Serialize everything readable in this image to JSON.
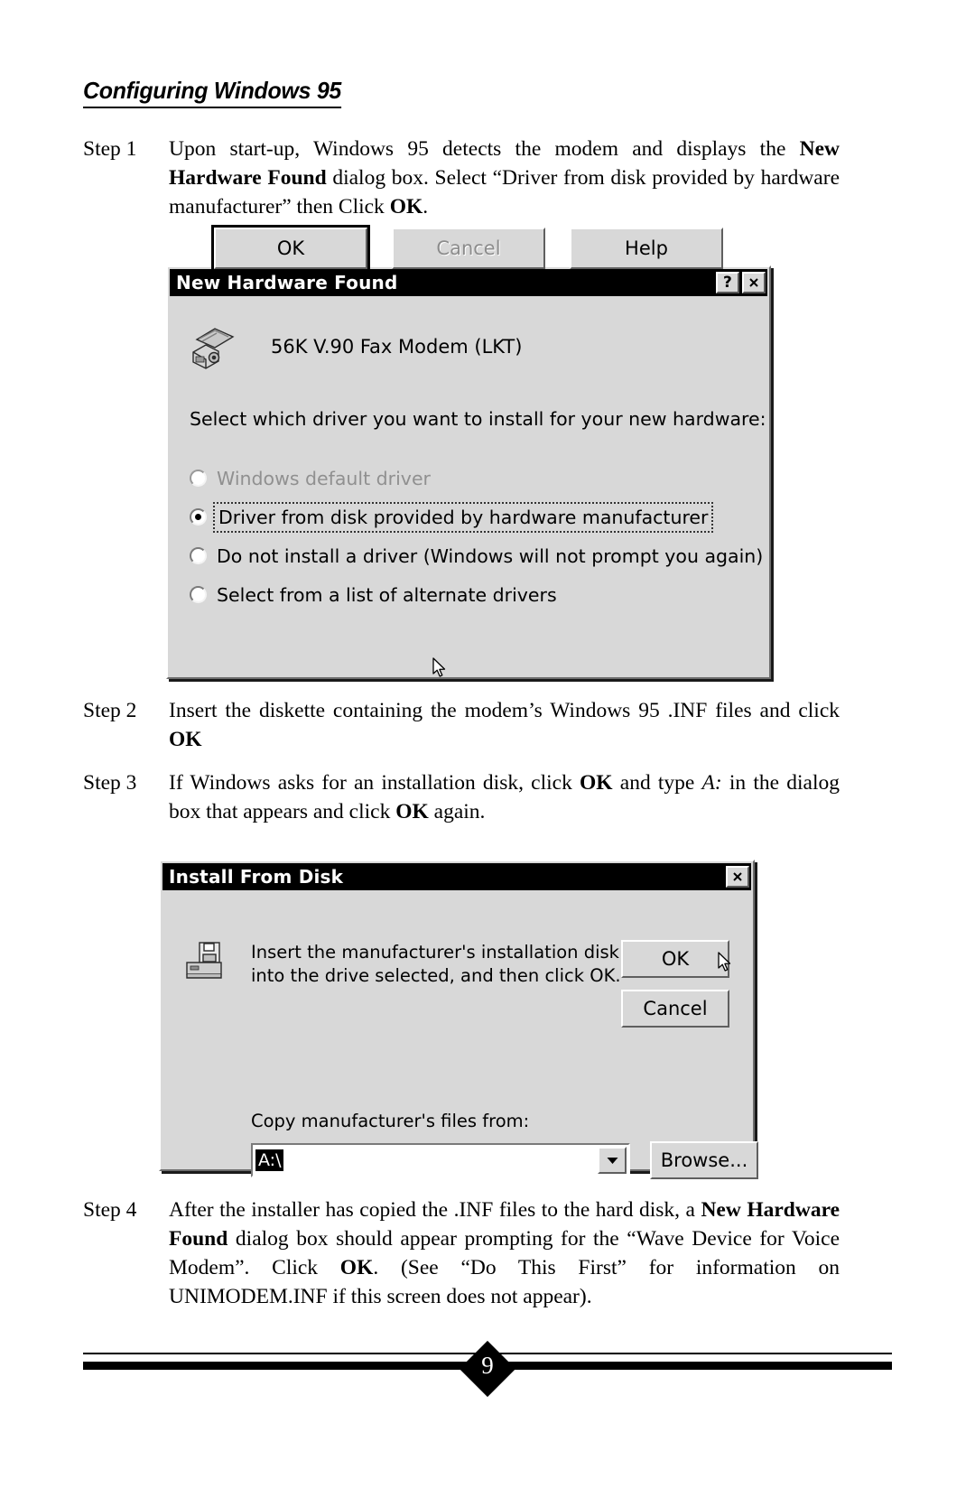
{
  "page": {
    "heading": "Configuring Windows 95",
    "page_number": "9"
  },
  "steps": [
    {
      "label": "Step 1",
      "text_html": "Upon start-up, Windows 95 detects the modem and displays the <b>New Hardware Found</b> dialog box. Select “Driver from disk provided by hardware manufacturer” then Click <b>OK</b>."
    },
    {
      "label": "Step 2",
      "text_html": "Insert the diskette containing the modem’s Windows 95 .INF files and click <b>OK</b>"
    },
    {
      "label": "Step 3",
      "text_html": "If Windows asks for an installation disk, click <b>OK</b> and type <i>A:</i> in the dialog box that appears and click <b>OK</b> again."
    },
    {
      "label": "Step 4",
      "text_html": "After the installer has copied the .INF files to the hard disk, a <b>New Hardware Found</b> dialog box should appear prompting for the “Wave Device for Voice Modem”. Click <b>OK</b>. (See “Do This First” for information on UNIMODEM.INF if this screen does not appear)."
    }
  ],
  "dialog_new_hardware": {
    "title": "New Hardware Found",
    "help_button": "?",
    "close_button": "✕",
    "device_name": "56K V.90 Fax Modem (LKT)",
    "prompt": "Select which driver you want to install for your new hardware:",
    "options": [
      {
        "label": "Windows default driver",
        "accel": "W",
        "checked": false,
        "disabled": true,
        "focused": false
      },
      {
        "label": "Driver from disk provided by hardware manufacturer",
        "accel": "m",
        "checked": true,
        "disabled": false,
        "focused": true
      },
      {
        "label": "Do not install a driver (Windows will not prompt you again)",
        "accel": "D",
        "checked": false,
        "disabled": false,
        "focused": false
      },
      {
        "label": "Select from a list of alternate drivers",
        "accel": "S",
        "checked": false,
        "disabled": false,
        "focused": false
      }
    ],
    "buttons": [
      {
        "label": "OK",
        "default": true,
        "disabled": false
      },
      {
        "label": "Cancel",
        "default": false,
        "disabled": true
      },
      {
        "label": "Help",
        "default": false,
        "disabled": false
      }
    ]
  },
  "dialog_install_from_disk": {
    "title": "Install From Disk",
    "close_button": "✕",
    "message": "Insert the manufacturer's installation disk into the drive selected, and then click OK.",
    "ok_label": "OK",
    "cancel_label": "Cancel",
    "copy_label": "Copy manufacturer's files from:",
    "path_value": "A:\\",
    "browse_label": "Browse...",
    "dropdown_arrow": "▼"
  },
  "colors": {
    "dialog_face": "#d8d8d8",
    "titlebar": "#000000",
    "titlebar_text": "#ffffff",
    "disabled_text": "#909090",
    "page_background": "#ffffff"
  }
}
